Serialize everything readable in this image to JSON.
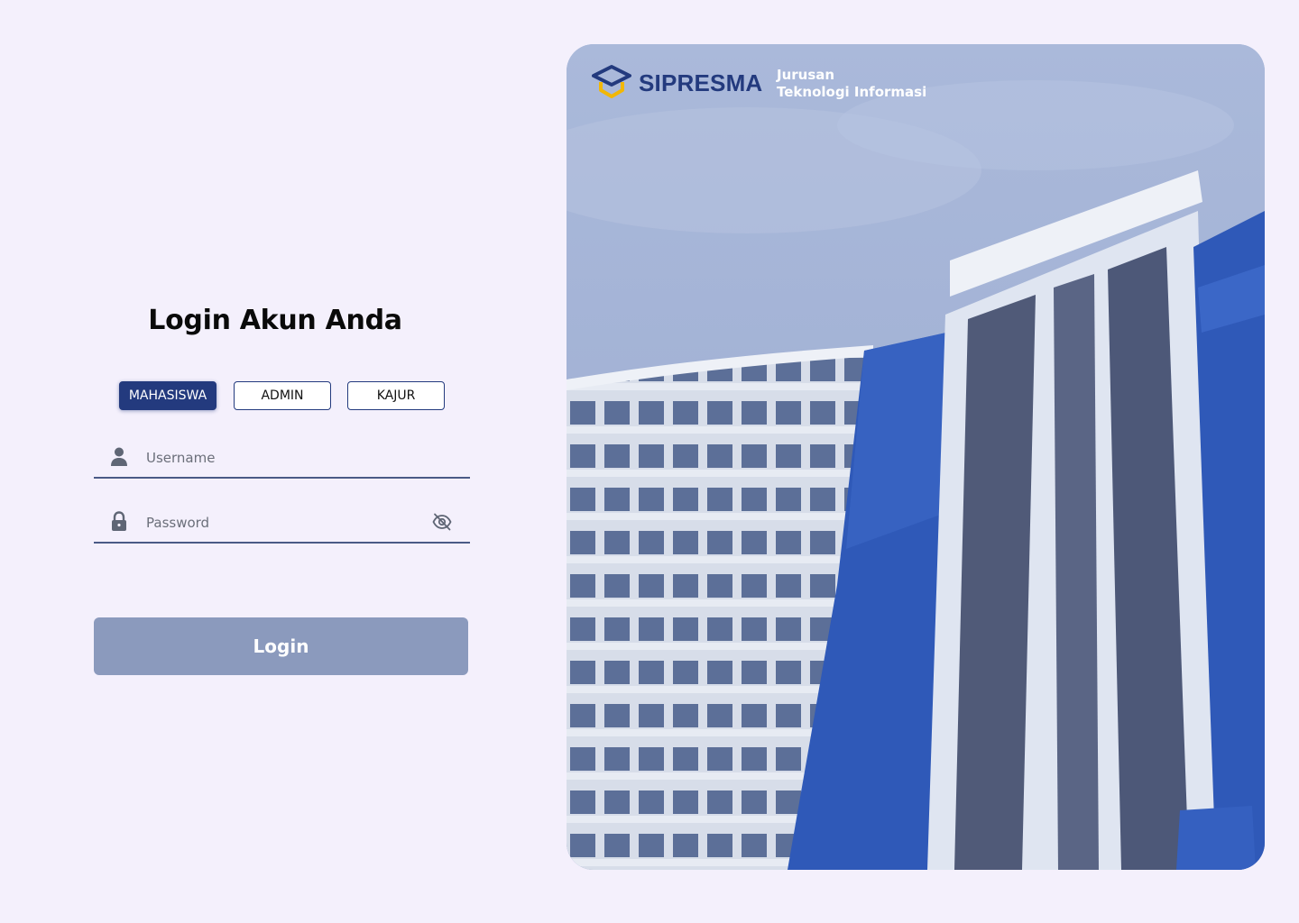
{
  "login": {
    "title": "Login Akun Anda",
    "roles": [
      {
        "label": "MAHASISWA",
        "active": true
      },
      {
        "label": "ADMIN",
        "active": false
      },
      {
        "label": "KAJUR",
        "active": false
      }
    ],
    "username": {
      "placeholder": "Username",
      "value": "",
      "icon": "user-icon"
    },
    "password": {
      "placeholder": "Password",
      "value": "",
      "icon": "lock-icon",
      "toggle_icon": "eye-off-icon"
    },
    "submit_label": "Login"
  },
  "hero": {
    "brand_name": "SIPRESMA",
    "dept_line1": "Jurusan",
    "dept_line2": "Teknologi Informasi",
    "image": "campus-building-photo"
  },
  "colors": {
    "background": "#f4f0fc",
    "primary": "#233a7e",
    "login_button": "#8b9abd",
    "accent_gold": "#f2b705"
  }
}
